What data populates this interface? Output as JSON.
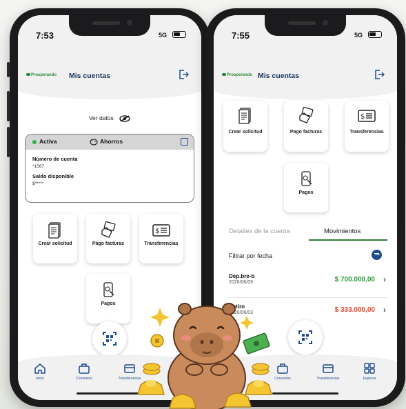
{
  "left_phone": {
    "status": {
      "time": "7:53",
      "network": "5G"
    },
    "header": {
      "logo_text": "Prosperando",
      "title": "Mis cuentas"
    },
    "ver_datos": "Ver datos",
    "account_card": {
      "status": "Activa",
      "type": "Ahorros",
      "account_label": "Número de cuenta",
      "account_value": "*1567",
      "balance_label": "Saldo disponible",
      "balance_value": "$*****"
    },
    "tiles": [
      {
        "label": "Crear solicitud",
        "icon": "document-icon"
      },
      {
        "label": "Pago facturas",
        "icon": "pay-bills-icon"
      },
      {
        "label": "Transferencias",
        "icon": "transfer-icon"
      },
      {
        "label": "Pagos",
        "icon": "payments-icon"
      }
    ],
    "nav": [
      {
        "label": "Inicio",
        "icon": "home-icon"
      },
      {
        "label": "Convenios",
        "icon": "briefcase-icon"
      },
      {
        "label": "Transferencias",
        "icon": "card-icon"
      }
    ]
  },
  "right_phone": {
    "status": {
      "time": "7:55",
      "network": "5G"
    },
    "header": {
      "logo_text": "Prosperando",
      "title": "Mis cuentas"
    },
    "tiles": [
      {
        "label": "Crear solicitud",
        "icon": "document-icon"
      },
      {
        "label": "Pago facturas",
        "icon": "pay-bills-icon"
      },
      {
        "label": "Transferencias",
        "icon": "transfer-icon"
      },
      {
        "label": "Pagos",
        "icon": "payments-icon"
      }
    ],
    "tabs": {
      "details": "Detalles de la cuenta",
      "movements": "Movimientos"
    },
    "filter_label": "Filtrar por fecha",
    "movements": [
      {
        "name": "Dep.bre-b",
        "date": "2026/06/09",
        "amount": "$ 700.000,00",
        "color": "#2a9b3a"
      },
      {
        "name": "Retiro",
        "date": "2026/06/03",
        "amount": "$ 333.000,00",
        "color": "#e0432c"
      }
    ],
    "nav": [
      {
        "label": "Convenios",
        "icon": "briefcase-icon"
      },
      {
        "label": "Transferencias",
        "icon": "card-icon"
      },
      {
        "label": "Explorar",
        "icon": "grid-icon"
      }
    ]
  },
  "colors": {
    "brand_blue": "#17355e",
    "icon_blue": "#1f4b8f",
    "green": "#2a9b3a",
    "red": "#e0432c"
  }
}
